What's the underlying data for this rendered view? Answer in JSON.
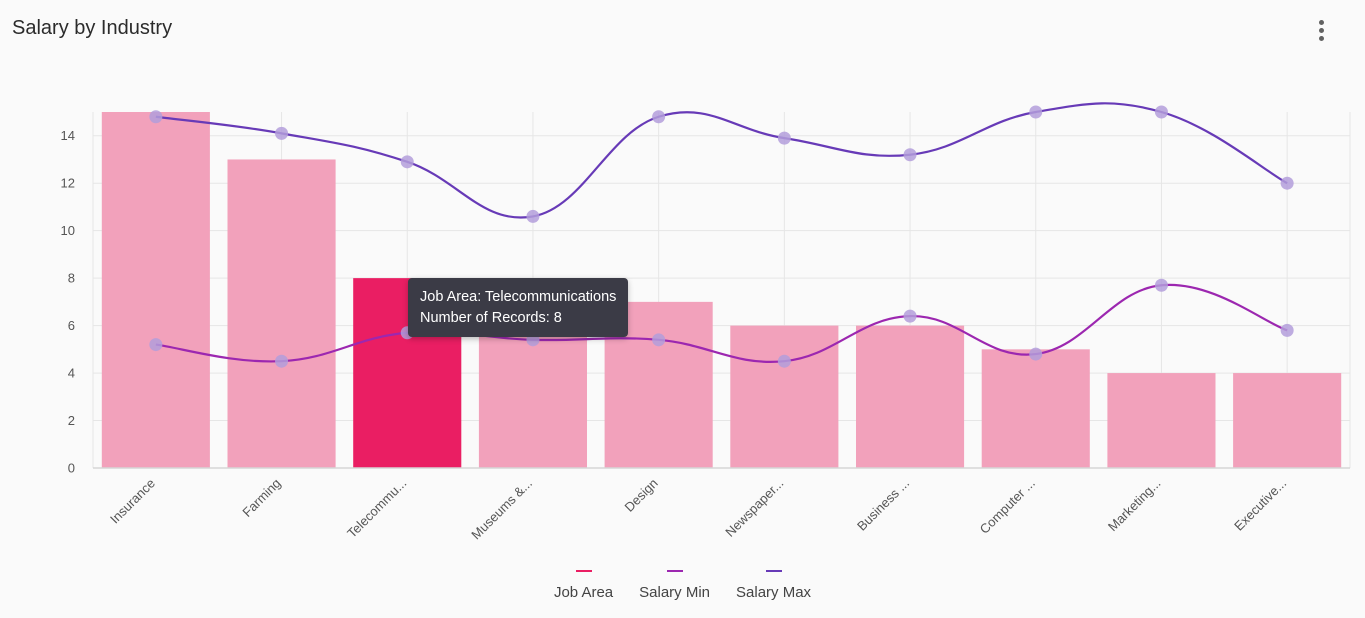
{
  "header": {
    "title": "Salary by Industry",
    "menu_icon": "more-vert-icon"
  },
  "tooltip": {
    "line1": "Job Area: Telecommunications",
    "line2": "Number of Records: 8"
  },
  "colors": {
    "bar": "#f2a1bb",
    "bar_highlight": "#ea1e63",
    "salary_min": "#9c27b0",
    "salary_max": "#673ab7",
    "marker": "#b39ddb",
    "grid": "#e6e6e6"
  },
  "legend": {
    "items": [
      {
        "label": "Job Area",
        "color": "#ea1e63"
      },
      {
        "label": "Salary Min",
        "color": "#9c27b0"
      },
      {
        "label": "Salary Max",
        "color": "#673ab7"
      }
    ]
  },
  "chart_data": {
    "type": "bar",
    "categories": [
      "Insurance",
      "Farming",
      "Telecommu...",
      "Museums &...",
      "Design",
      "Newspaper...",
      "Business ...",
      "Computer ...",
      "Marketing...",
      "Executive..."
    ],
    "highlight_index": 2,
    "series": [
      {
        "name": "Job Area",
        "type": "bar",
        "values": [
          15,
          13,
          8,
          6,
          7,
          6,
          6,
          5,
          4,
          4
        ]
      },
      {
        "name": "Salary Min",
        "type": "line",
        "values": [
          5.2,
          4.5,
          5.7,
          5.4,
          5.4,
          4.5,
          6.4,
          4.8,
          7.7,
          5.8
        ]
      },
      {
        "name": "Salary Max",
        "type": "line",
        "values": [
          14.8,
          14.1,
          12.9,
          10.6,
          14.8,
          13.9,
          13.2,
          15,
          15,
          12
        ]
      }
    ],
    "yticks": [
      0,
      2,
      4,
      6,
      8,
      10,
      12,
      14
    ],
    "ylim": [
      0,
      15
    ],
    "grid": true,
    "legend_position": "bottom"
  }
}
